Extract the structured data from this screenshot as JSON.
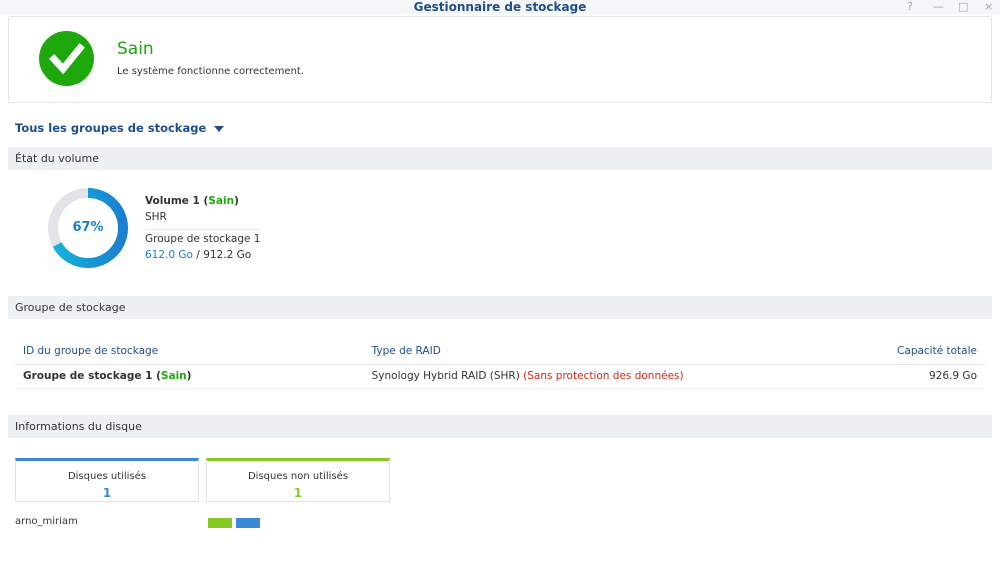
{
  "window": {
    "title": "Gestionnaire de stockage",
    "controls": [
      "?",
      "—",
      "□",
      "×"
    ]
  },
  "status": {
    "title": "Sain",
    "message": "Le système fonctionne correctement.",
    "color": "#1ea80b"
  },
  "group_selector": {
    "label": "Tous les groupes de stockage"
  },
  "volume_section": {
    "title": "État du volume",
    "volume": {
      "name": "Volume 1",
      "status": "Sain",
      "type": "SHR",
      "group": "Groupe de stockage 1",
      "used": "612.0 Go",
      "total": "912.2 Go",
      "percent_label": "67%",
      "percent": 67
    }
  },
  "pool_section": {
    "title": "Groupe de stockage",
    "columns": [
      "ID du groupe de stockage",
      "Type de RAID",
      "Capacité totale"
    ],
    "rows": [
      {
        "id": "Groupe de stockage 1",
        "status": "Sain",
        "raid": "Synology Hybrid RAID (SHR)",
        "warning": "(Sans protection des données)",
        "capacity": "926.9 Go"
      }
    ]
  },
  "disk_section": {
    "title": "Informations du disque",
    "used": {
      "label": "Disques utilisés",
      "count": "1",
      "color": "#3a87d4"
    },
    "unused": {
      "label": "Disques non utilisés",
      "count": "1",
      "color": "#86c924"
    },
    "disks": [
      {
        "name": "arno_miriam"
      }
    ]
  }
}
